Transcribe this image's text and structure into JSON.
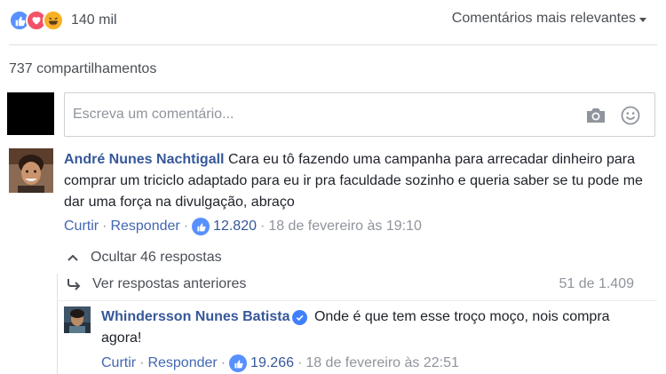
{
  "reactions": {
    "icons": [
      "like-icon",
      "love-icon",
      "haha-icon"
    ],
    "count": "140 mil"
  },
  "sort": {
    "label": "Comentários mais relevantes"
  },
  "shares": {
    "label": "737 compartilhamentos"
  },
  "composer": {
    "placeholder": "Escreva um comentário..."
  },
  "comment": {
    "author": "André Nunes Nachtigall",
    "text": "Cara eu tô fazendo uma campanha para arrecadar dinheiro para comprar um triciclo adaptado para eu ir pra faculdade sozinho e queria saber se tu pode me dar uma força na divulgação, abraço",
    "like_label": "Curtir",
    "reply_label": "Responder",
    "likes": "12.820",
    "timestamp": "18 de fevereiro às 19:10",
    "hide_replies": "Ocultar 46 respostas"
  },
  "replies": {
    "view_previous": "Ver respostas anteriores",
    "page_count": "51 de 1.409",
    "reply": {
      "author": "Whindersson Nunes Batista",
      "text": "Onde é que tem esse troço moço, nois compra agora!",
      "like_label": "Curtir",
      "reply_label": "Responder",
      "likes": "19.266",
      "timestamp": "18 de fevereiro às 22:51"
    }
  },
  "colors": {
    "link": "#4267b2",
    "author": "#365899",
    "like_blue": "#5890ff",
    "love_red": "#f25268",
    "haha_yellow": "#f7b125"
  }
}
